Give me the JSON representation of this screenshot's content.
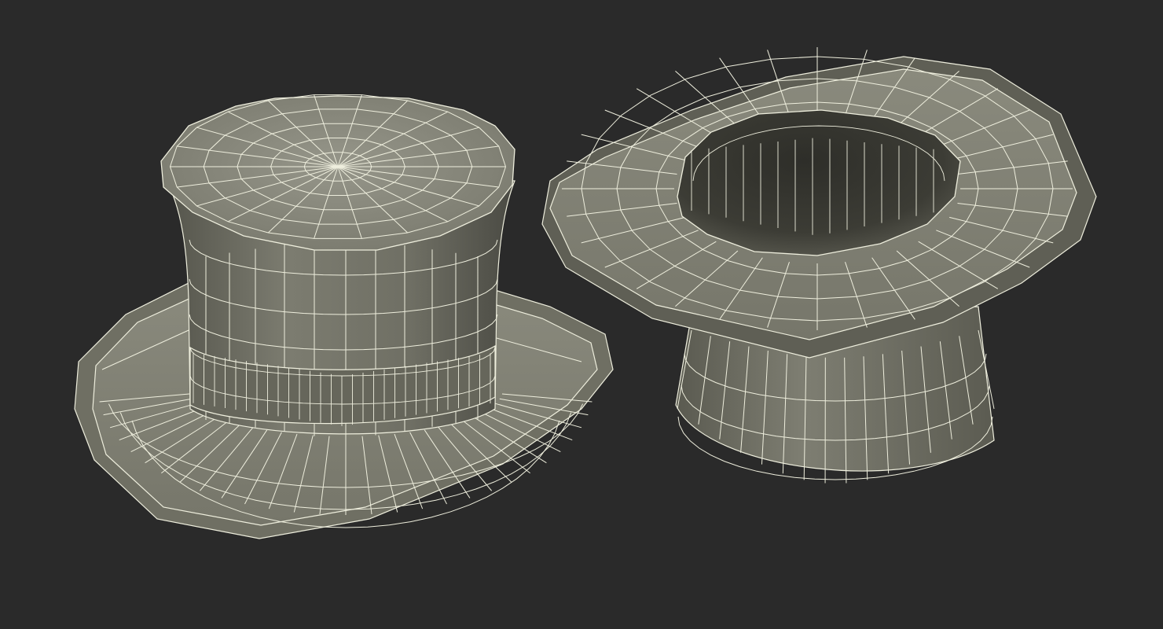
{
  "scene": {
    "background": "#2a2a2a",
    "surface_light": "#8d8d7f",
    "surface_mid": "#727266",
    "surface_dark": "#3b3b36",
    "wire_color": "#eeeedd"
  },
  "objects": [
    {
      "name": "top-hat-upright",
      "orientation": "upright"
    },
    {
      "name": "top-hat-inverted",
      "orientation": "upside-down"
    }
  ]
}
